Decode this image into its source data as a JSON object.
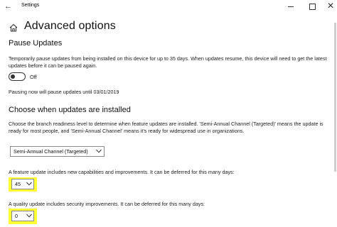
{
  "window": {
    "title": "Settings",
    "back_icon": "arrow-left-icon"
  },
  "page": {
    "title": "Advanced options",
    "home_icon": "home-icon"
  },
  "pause": {
    "heading": "Pause Updates",
    "description": "Temporarily pause updates from being installed on this device for up to 35 days. When updates resume, this device will need to get the latest updates before it can be paused again.",
    "toggle_state": "Off",
    "status": "Pausing now will pause updates until 03/01/2019"
  },
  "choose": {
    "heading": "Choose when updates are installed",
    "description": "Choose the branch readiness level to determine when feature updates are installed. 'Semi-Annual Channel (Targeted)' means the update is ready for most people, and 'Semi-Annual Channel' means it's ready for widespread use in organizations.",
    "channel_value": "Semi-Annual Channel (Targeted)"
  },
  "feature": {
    "description": "A feature update includes new capabilities and improvements. It can be deferred for this many days:",
    "value": "45"
  },
  "quality": {
    "description": "A quality update includes security improvements. It can be deferred for this many days:",
    "value": "0"
  },
  "colors": {
    "highlight": "#ffff33",
    "text": "#222222"
  }
}
